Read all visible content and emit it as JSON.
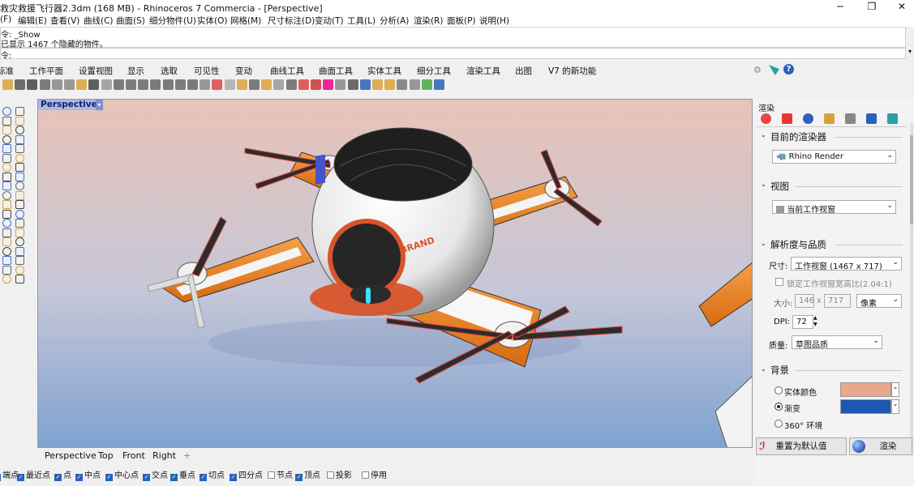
{
  "window": {
    "title": "救灾救援飞行器2.3dm (168 MB) - Rhinoceros 7 Commercia - [Perspective]",
    "minimize": "─",
    "maximize": "❐",
    "close": "✕"
  },
  "menus": [
    "(F)",
    "编辑(E)",
    "查看(V)",
    "曲线(C)",
    "曲面(S)",
    "细分物件(U)",
    "实体(O)",
    "网格(M)",
    "尺寸标注(D)",
    "变动(T)",
    "工具(L)",
    "分析(A)",
    "渲染(R)",
    "面板(P)",
    "说明(H)"
  ],
  "command": {
    "history1": "令: _Show",
    "history2": "已显示 1467 个隐藏的物件。",
    "prompt": "令:"
  },
  "tabs": [
    "标准",
    "工作平面",
    "设置视图",
    "显示",
    "选取",
    "可见性",
    "变动",
    "曲线工具",
    "曲面工具",
    "实体工具",
    "细分工具",
    "渲染工具",
    "出图",
    "V7 的新功能"
  ],
  "viewport": {
    "label": "Perspective",
    "tabs": [
      "Perspective",
      "Top",
      "Front",
      "Right"
    ],
    "add_tab": "+",
    "brand_text": "BRAND"
  },
  "osnaps": [
    {
      "label": "端点",
      "checked": true
    },
    {
      "label": "最近点",
      "checked": true
    },
    {
      "label": "点",
      "checked": true
    },
    {
      "label": "中点",
      "checked": true
    },
    {
      "label": "中心点",
      "checked": true
    },
    {
      "label": "交点",
      "checked": true
    },
    {
      "label": "垂点",
      "checked": true
    },
    {
      "label": "切点",
      "checked": true
    },
    {
      "label": "四分点",
      "checked": true
    },
    {
      "label": "节点",
      "checked": false
    },
    {
      "label": "顶点",
      "checked": true
    },
    {
      "label": "投影",
      "checked": false
    },
    {
      "label": "停用",
      "checked": false
    }
  ],
  "panel": {
    "title": "渲染",
    "current_renderer_heading": "目前的渲染器",
    "renderer": "Rhino Render",
    "view_heading": "视图",
    "view_value": "当前工作视窗",
    "resolution_heading": "解析度与品质",
    "size_label": "尺寸:",
    "size_value": "工作视窗 (1467 x 717)",
    "lock_label": "锁定工作视窗宽高比(2.04:1)",
    "dims_label": "大小:",
    "width": "146",
    "x_sep": "x",
    "height": "717",
    "unit": "像素",
    "dpi_label": "DPI:",
    "dpi": "72",
    "quality_label": "质量:",
    "quality": "草图品质",
    "background_heading": "背景",
    "bg_options": [
      "实体颜色",
      "渐变",
      "360° 环境"
    ],
    "bg_selected": "渐变",
    "solid_color": "#e8a88c",
    "gradient_color": "#1e57b0",
    "reset_button": "重置为默认值",
    "render_button": "渲染"
  },
  "colors": {
    "accent": "#2a62b8",
    "drone_orange": "#f08a24",
    "viewport_top": "#e8c3b7",
    "viewport_bottom": "#7fa2d0"
  }
}
